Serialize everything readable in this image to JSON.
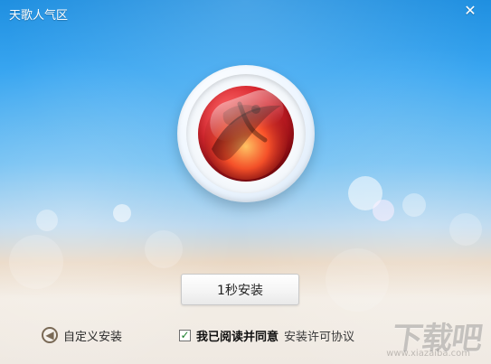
{
  "window": {
    "title": "天歌人气区",
    "close_symbol": "✕"
  },
  "main": {
    "install_button_label": "1秒安装"
  },
  "footer": {
    "custom_install_label": "自定义安装",
    "agree_label": "我已阅读并同意",
    "license_link_label": "安装许可协议",
    "agree_checked": true
  },
  "watermark": {
    "brand_text": "下载吧",
    "url_text": "www.xiazaiba.com"
  },
  "colors": {
    "sky_top": "#1f8fe0",
    "logo_red": "#d8262e"
  },
  "icons": {
    "close": "close-icon",
    "back": "back-arrow-icon",
    "check": "checkmark-icon",
    "logo": "app-logo-icon"
  }
}
